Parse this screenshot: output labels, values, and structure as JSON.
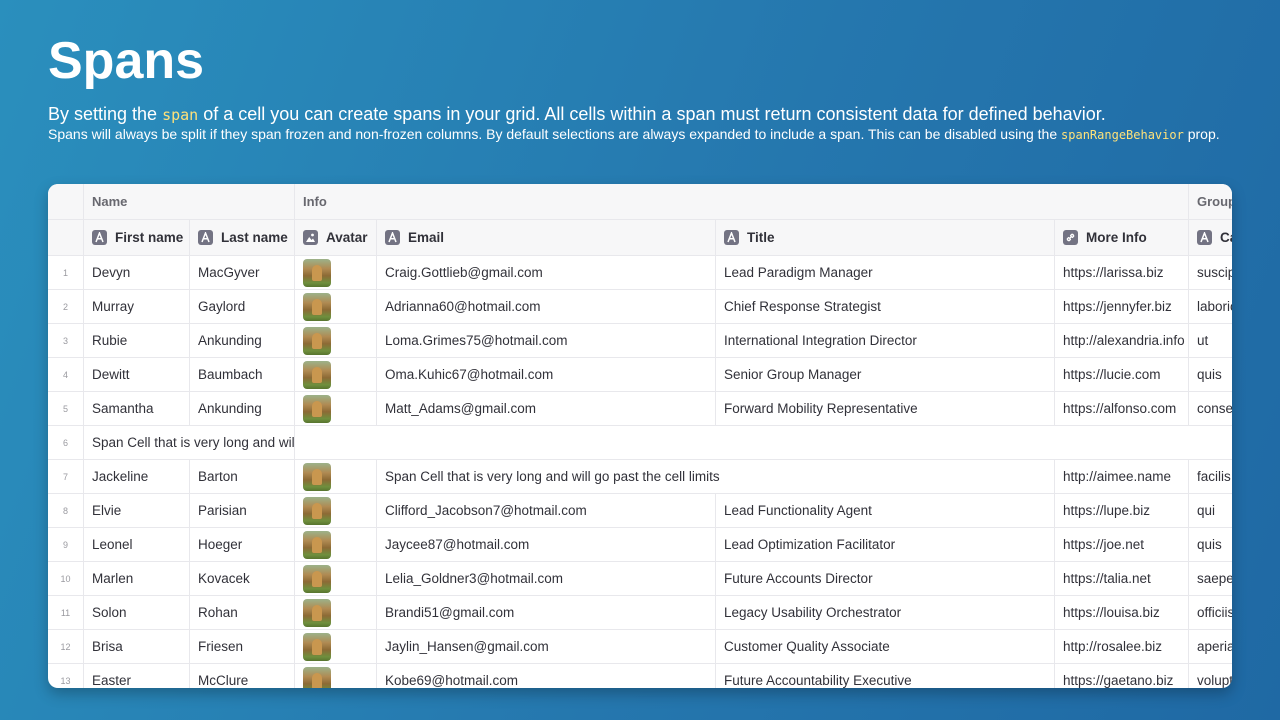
{
  "header": {
    "title": "Spans",
    "lead_before": "By setting the ",
    "lead_code": "span",
    "lead_after": " of a cell you can create spans in your grid. All cells within a span must return consistent data for defined behavior.",
    "sub_before": "Spans will always be split if they span frozen and non-frozen columns. By default selections are always expanded to include a span. This can be disabled using the ",
    "sub_code": "spanRangeBehavior",
    "sub_after": " prop."
  },
  "grid": {
    "groups": [
      "Name",
      "Info",
      "Group"
    ],
    "columns": [
      {
        "label": "First name",
        "icon": "text-icon"
      },
      {
        "label": "Last name",
        "icon": "text-icon"
      },
      {
        "label": "Avatar",
        "icon": "image-icon"
      },
      {
        "label": "Email",
        "icon": "text-icon"
      },
      {
        "label": "Title",
        "icon": "text-icon"
      },
      {
        "label": "More Info",
        "icon": "link-icon"
      },
      {
        "label": "Category",
        "icon": "text-icon"
      }
    ],
    "rows": [
      {
        "num": "1",
        "first": "Devyn",
        "last": "MacGyver",
        "email": "Craig.Gottlieb@gmail.com",
        "title": "Lead Paradigm Manager",
        "more": "https://larissa.biz",
        "extra": "suscipit"
      },
      {
        "num": "2",
        "first": "Murray",
        "last": "Gaylord",
        "email": "Adrianna60@hotmail.com",
        "title": "Chief Response Strategist",
        "more": "https://jennyfer.biz",
        "extra": "laboriosam"
      },
      {
        "num": "3",
        "first": "Rubie",
        "last": "Ankunding",
        "email": "Loma.Grimes75@hotmail.com",
        "title": "International Integration Director",
        "more": "http://alexandria.info",
        "extra": "ut"
      },
      {
        "num": "4",
        "first": "Dewitt",
        "last": "Baumbach",
        "email": "Oma.Kuhic67@hotmail.com",
        "title": "Senior Group Manager",
        "more": "https://lucie.com",
        "extra": "quis"
      },
      {
        "num": "5",
        "first": "Samantha",
        "last": "Ankunding",
        "email": "Matt_Adams@gmail.com",
        "title": "Forward Mobility Representative",
        "more": "https://alfonso.com",
        "extra": "consequatur"
      },
      {
        "num": "6",
        "span_full": "Span Cell that is very long and will go past the cell limits"
      },
      {
        "num": "7",
        "first": "Jackeline",
        "last": "Barton",
        "span_info": "Span Cell that is very long and will go past the cell limits",
        "more": "http://aimee.name",
        "extra": "facilis"
      },
      {
        "num": "8",
        "first": "Elvie",
        "last": "Parisian",
        "email": "Clifford_Jacobson7@hotmail.com",
        "title": "Lead Functionality Agent",
        "more": "https://lupe.biz",
        "extra": "qui"
      },
      {
        "num": "9",
        "first": "Leonel",
        "last": "Hoeger",
        "email": "Jaycee87@hotmail.com",
        "title": "Lead Optimization Facilitator",
        "more": "https://joe.net",
        "extra": "quis"
      },
      {
        "num": "10",
        "first": "Marlen",
        "last": "Kovacek",
        "email": "Lelia_Goldner3@hotmail.com",
        "title": "Future Accounts Director",
        "more": "https://talia.net",
        "extra": "saepe"
      },
      {
        "num": "11",
        "first": "Solon",
        "last": "Rohan",
        "email": "Brandi51@gmail.com",
        "title": "Legacy Usability Orchestrator",
        "more": "https://louisa.biz",
        "extra": "officiis"
      },
      {
        "num": "12",
        "first": "Brisa",
        "last": "Friesen",
        "email": "Jaylin_Hansen@gmail.com",
        "title": "Customer Quality Associate",
        "more": "http://rosalee.biz",
        "extra": "aperiam"
      },
      {
        "num": "13",
        "first": "Easter",
        "last": "McClure",
        "email": "Kobe69@hotmail.com",
        "title": "Future Accountability Executive",
        "more": "https://gaetano.biz",
        "extra": "voluptas"
      }
    ]
  }
}
